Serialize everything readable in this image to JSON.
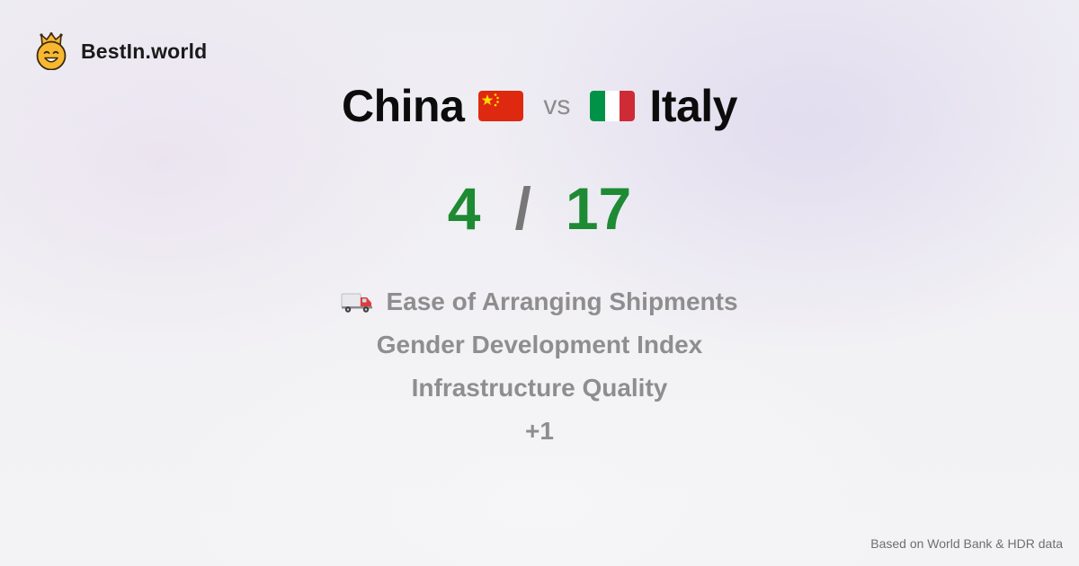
{
  "brand": {
    "name": "BestIn.world",
    "icon": "smiling-crown-face-icon"
  },
  "comparison": {
    "left_country": "China",
    "left_flag": "china-flag-icon",
    "separator": "vs",
    "right_country": "Italy",
    "right_flag": "italy-flag-icon"
  },
  "score": {
    "left": "4",
    "divider": "/",
    "right": "17"
  },
  "metrics": [
    {
      "label": "Ease of Arranging Shipments",
      "icon": "truck-icon"
    },
    {
      "label": "Gender Development Index"
    },
    {
      "label": "Infrastructure Quality"
    },
    {
      "label": "+1"
    }
  ],
  "footer": {
    "source": "Based on World Bank & HDR data"
  },
  "colors": {
    "score_green": "#1e8a34",
    "metric_gray": "#8e8e8e",
    "china_red": "#de2910",
    "china_star": "#ffde00",
    "italy_green": "#009246",
    "italy_white": "#ffffff",
    "italy_red": "#ce2b37",
    "logo_yellow": "#f7b731"
  }
}
